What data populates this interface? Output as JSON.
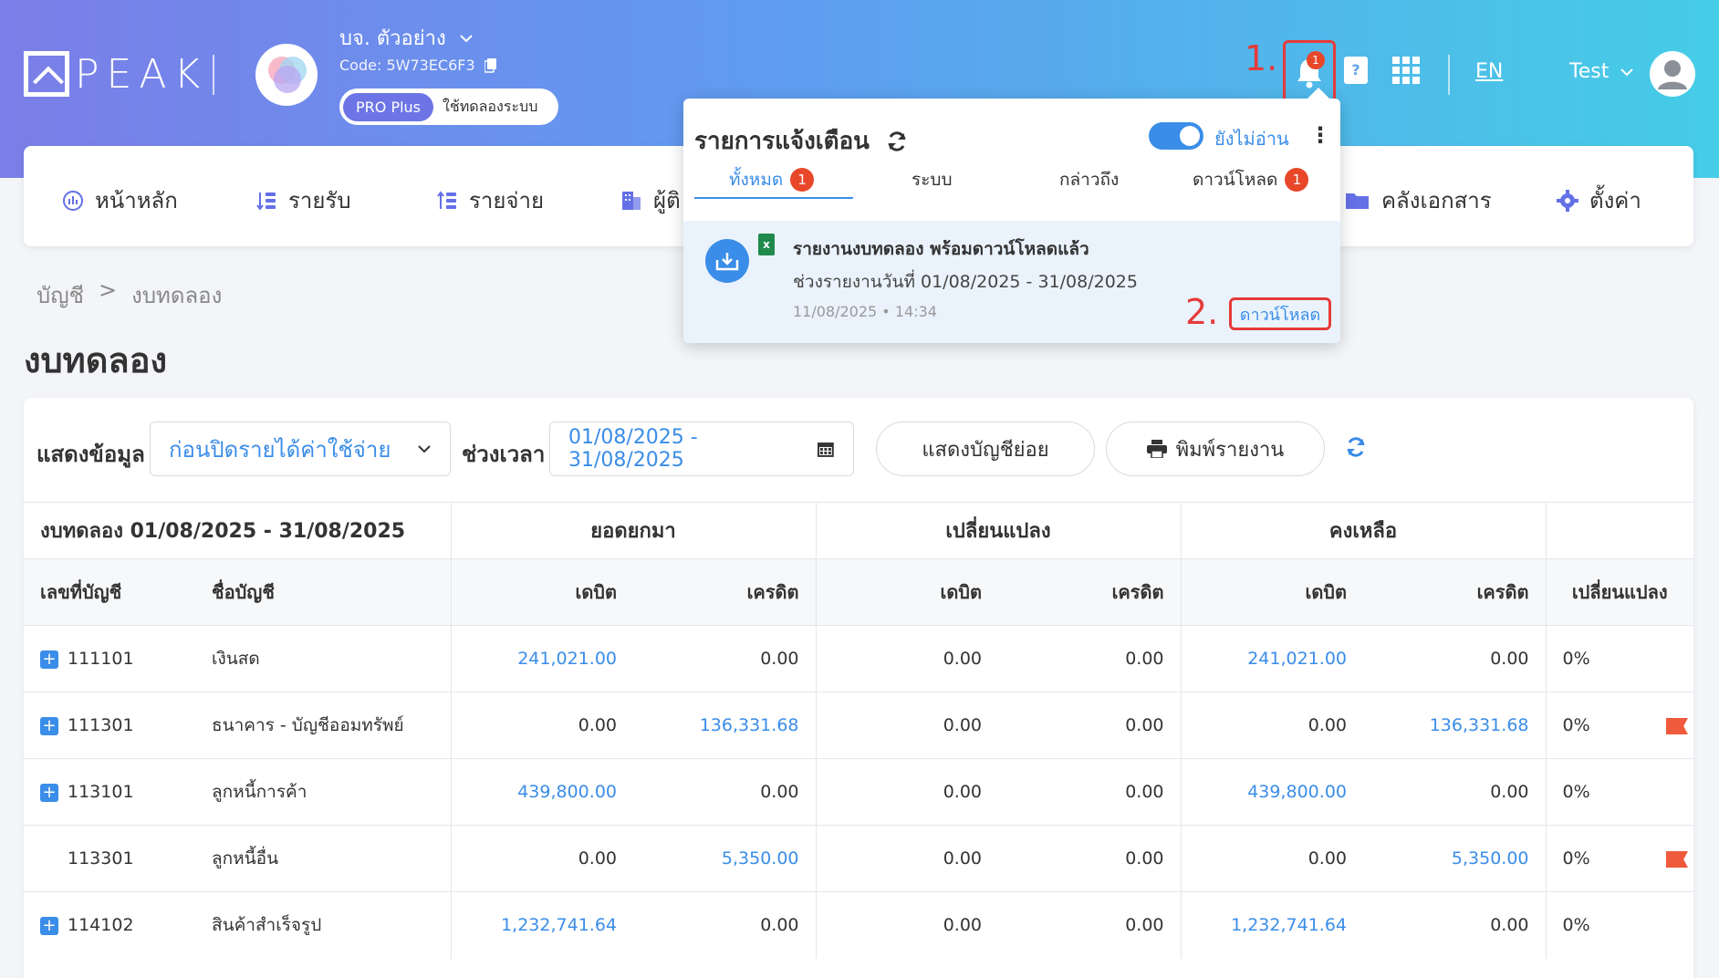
{
  "header": {
    "brand": "PEAK",
    "company_name": "บจ. ตัวอย่าง",
    "company_code": "Code: 5W73EC6F3",
    "plan_badge": "PRO Plus",
    "plan_trial": "ใช้ทดลองระบบ",
    "step1": "1.",
    "bell_count": "1",
    "lang": "EN",
    "user": "Test",
    "icons": [
      "bell-icon",
      "help-book-icon",
      "apps-grid-icon",
      "user-avatar-icon"
    ]
  },
  "nav": {
    "items": [
      {
        "label": "หน้าหลัก",
        "icon": "dashboard-icon"
      },
      {
        "label": "รายรับ",
        "icon": "income-icon"
      },
      {
        "label": "รายจ่าย",
        "icon": "expense-icon"
      },
      {
        "label": "ผู้ติ",
        "icon": "contacts-icon"
      },
      {
        "label": "คลังเอกสาร",
        "icon": "folder-icon"
      },
      {
        "label": "ตั้งค่า",
        "icon": "gear-icon"
      }
    ]
  },
  "breadcrumb": {
    "root": "บัญชี",
    "sep": ">",
    "current": "งบทดลอง"
  },
  "page_title": "งบทดลอง",
  "filters": {
    "show_label": "แสดงข้อมูล",
    "show_value": "ก่อนปิดรายได้ค่าใช้จ่าย",
    "period_label": "ช่วงเวลา",
    "period_value": "01/08/2025 - 31/08/2025",
    "sub_accounts_btn": "แสดงบัญชีย่อย",
    "print_btn": "พิมพ์รายงาน"
  },
  "table": {
    "title": "งบทดลอง 01/08/2025 - 31/08/2025",
    "groups": [
      "ยอดยกมา",
      "เปลี่ยนแปลง",
      "คงเหลือ"
    ],
    "columns": [
      "เลขที่บัญชี",
      "ชื่อบัญชี",
      "เดบิต",
      "เครดิต",
      "เดบิต",
      "เครดิต",
      "เดบิต",
      "เครดิต",
      "เปลี่ยนแปลง"
    ],
    "rows": [
      {
        "expand": true,
        "code": "111101",
        "name": "เงินสด",
        "v": [
          "241,021.00",
          "0.00",
          "0.00",
          "0.00",
          "241,021.00",
          "0.00"
        ],
        "links": [
          0,
          4
        ],
        "pct": "0%",
        "flag": false
      },
      {
        "expand": true,
        "code": "111301",
        "name": "ธนาคาร - บัญชีออมทรัพย์",
        "v": [
          "0.00",
          "136,331.68",
          "0.00",
          "0.00",
          "0.00",
          "136,331.68"
        ],
        "links": [
          1,
          5
        ],
        "pct": "0%",
        "flag": true
      },
      {
        "expand": true,
        "code": "113101",
        "name": "ลูกหนี้การค้า",
        "v": [
          "439,800.00",
          "0.00",
          "0.00",
          "0.00",
          "439,800.00",
          "0.00"
        ],
        "links": [
          0,
          4
        ],
        "pct": "0%",
        "flag": false
      },
      {
        "expand": false,
        "code": "113301",
        "name": "ลูกหนี้อื่น",
        "v": [
          "0.00",
          "5,350.00",
          "0.00",
          "0.00",
          "0.00",
          "5,350.00"
        ],
        "links": [
          1,
          5
        ],
        "pct": "0%",
        "flag": true
      },
      {
        "expand": true,
        "code": "114102",
        "name": "สินค้าสำเร็จรูป",
        "v": [
          "1,232,741.64",
          "0.00",
          "0.00",
          "0.00",
          "1,232,741.64",
          "0.00"
        ],
        "links": [
          0,
          4
        ],
        "pct": "0%",
        "flag": false
      }
    ]
  },
  "notifications": {
    "title": "รายการแจ้งเตือน",
    "unread_toggle_label": "ยังไม่อ่าน",
    "tabs": [
      {
        "label": "ทั้งหมด",
        "badge": "1"
      },
      {
        "label": "ระบบ",
        "badge": ""
      },
      {
        "label": "กล่าวถึง",
        "badge": ""
      },
      {
        "label": "ดาวน์โหลด",
        "badge": "1"
      }
    ],
    "item": {
      "title": "รายงานงบทดลอง พร้อมดาวน์โหลดแล้ว",
      "desc": "ช่วงรายงานวันที่ 01/08/2025 - 31/08/2025",
      "time": "11/08/2025 • 14:34",
      "action": "ดาวน์โหลด",
      "step": "2."
    }
  },
  "colors": {
    "accent": "#3a8de8",
    "brand_start": "#7b7ee8",
    "brand_end": "#45cde6",
    "alert": "#e63b3b"
  }
}
